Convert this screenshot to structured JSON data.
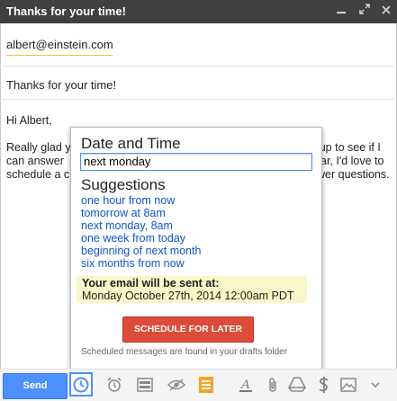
{
  "window": {
    "title": "Thanks for your time!"
  },
  "compose": {
    "recipient": "albert@einstein.com",
    "subject": "Thanks for your time!",
    "body_lines": [
      "Hi Albert,",
      "Really glad y",
      "can answer",
      "schedule a c"
    ],
    "body_right_lines": [
      "y up to see if I",
      "ar, I'd love to",
      "wer questions."
    ]
  },
  "popup": {
    "date_time_heading": "Date and Time",
    "date_time_value": "next monday",
    "suggestions_heading": "Suggestions",
    "suggestions": [
      "one hour from now",
      "tomorrow at 8am",
      "next monday, 8am",
      "one week from today",
      "beginning of next month",
      "six months from now"
    ],
    "sent_label": "Your email will be sent at:",
    "sent_datetime": "Monday October 27th, 2014 12:00am PDT",
    "schedule_button": "SCHEDULE FOR LATER",
    "footnote": "Scheduled messages are found in your drafts folder"
  },
  "toolbar": {
    "send_label": "Send",
    "icons": [
      "clock-icon",
      "alarm-icon",
      "template-icon",
      "eye-icon",
      "notes-icon",
      "formatting-icon",
      "attach-icon",
      "drive-icon",
      "money-icon",
      "photo-icon"
    ]
  },
  "colors": {
    "accent": "#4d90fe",
    "schedule": "#dd4b39",
    "highlight": "#f9f7c8",
    "link": "#1155cc"
  }
}
